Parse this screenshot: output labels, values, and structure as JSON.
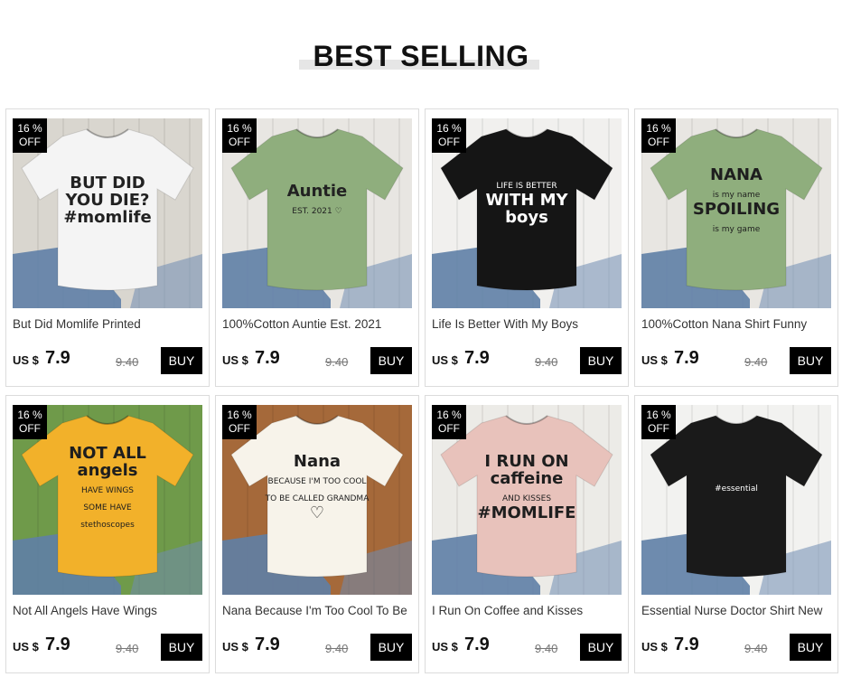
{
  "section": {
    "title": "BEST SELLING"
  },
  "products": [
    {
      "name": "But Did Momlife Printed",
      "discount_top": "16 %",
      "discount_bottom": "OFF",
      "currency": "US $",
      "price": "7.9",
      "old_price": "9.40",
      "buy_label": "BUY",
      "shirt_color": "#f4f4f4",
      "bg_color": "#d9d6cf",
      "print_lines": [
        "BUT DID",
        "YOU DIE?",
        "#momlife"
      ],
      "ink": "#222222"
    },
    {
      "name": "100%Cotton Auntie Est. 2021",
      "discount_top": "16 %",
      "discount_bottom": "OFF",
      "currency": "US $",
      "price": "7.9",
      "old_price": "9.40",
      "buy_label": "BUY",
      "shirt_color": "#8fae7d",
      "bg_color": "#e8e6e2",
      "print_lines": [
        "Auntie",
        "EST. 2021 ♡"
      ],
      "ink": "#222222"
    },
    {
      "name": "Life Is Better With My Boys",
      "discount_top": "16 %",
      "discount_bottom": "OFF",
      "currency": "US $",
      "price": "7.9",
      "old_price": "9.40",
      "buy_label": "BUY",
      "shirt_color": "#151515",
      "bg_color": "#f1f0ee",
      "print_lines": [
        "LIFE IS BETTER",
        "WITH MY",
        "boys"
      ],
      "ink": "#ffffff"
    },
    {
      "name": "100%Cotton Nana Shirt Funny",
      "discount_top": "16 %",
      "discount_bottom": "OFF",
      "currency": "US $",
      "price": "7.9",
      "old_price": "9.40",
      "buy_label": "BUY",
      "shirt_color": "#8fae7d",
      "bg_color": "#e8e6e2",
      "print_lines": [
        "NANA",
        "is my name",
        "SPOILING",
        "is my game"
      ],
      "ink": "#1e1e1e"
    },
    {
      "name": "Not All Angels Have Wings",
      "discount_top": "16 %",
      "discount_bottom": "OFF",
      "currency": "US $",
      "price": "7.9",
      "old_price": "9.40",
      "buy_label": "BUY",
      "shirt_color": "#f2b12a",
      "bg_color": "#6f9a4a",
      "print_lines": [
        "NOT ALL",
        "angels",
        "HAVE WINGS",
        "SOME HAVE",
        "stethoscopes"
      ],
      "ink": "#1e1e1e"
    },
    {
      "name": "Nana Because I'm Too Cool To Be",
      "discount_top": "16 %",
      "discount_bottom": "OFF",
      "currency": "US $",
      "price": "7.9",
      "old_price": "9.40",
      "buy_label": "BUY",
      "shirt_color": "#f7f3ea",
      "bg_color": "#a5693a",
      "print_lines": [
        "Nana",
        "BECAUSE I'M TOO COOL",
        "TO BE CALLED GRANDMA",
        "♡"
      ],
      "ink": "#1e1e1e"
    },
    {
      "name": "I Run On Coffee and Kisses",
      "discount_top": "16 %",
      "discount_bottom": "OFF",
      "currency": "US $",
      "price": "7.9",
      "old_price": "9.40",
      "buy_label": "BUY",
      "shirt_color": "#e8c2bb",
      "bg_color": "#ecebe7",
      "print_lines": [
        "I RUN ON",
        "caffeine",
        "AND KISSES",
        "#MOMLIFE"
      ],
      "ink": "#1e1e1e"
    },
    {
      "name": "Essential Nurse Doctor Shirt New",
      "discount_top": "16 %",
      "discount_bottom": "OFF",
      "currency": "US $",
      "price": "7.9",
      "old_price": "9.40",
      "buy_label": "BUY",
      "shirt_color": "#1a1a1a",
      "bg_color": "#f2f2f0",
      "print_lines": [
        "#essential"
      ],
      "ink": "#ffffff"
    }
  ]
}
